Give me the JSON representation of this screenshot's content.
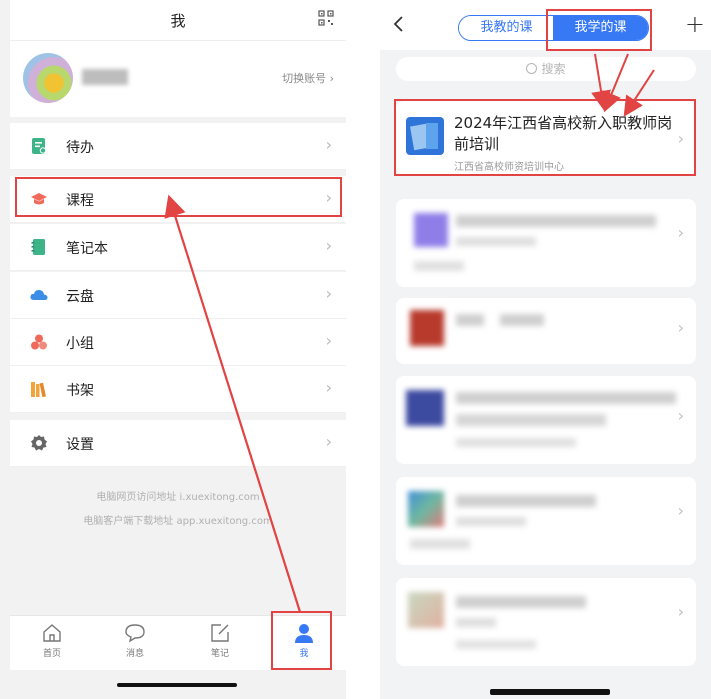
{
  "left": {
    "header_title": "我",
    "switch_account": "切换账号",
    "menu": [
      {
        "label": "待办",
        "icon": "todo-icon",
        "color": "#3eb489"
      },
      {
        "label": "课程",
        "icon": "course-icon",
        "color": "#ef6a5a"
      },
      {
        "label": "笔记本",
        "icon": "notebook-icon",
        "color": "#3eb489"
      },
      {
        "label": "云盘",
        "icon": "cloud-icon",
        "color": "#3a8ee6"
      },
      {
        "label": "小组",
        "icon": "group-icon",
        "color": "#ef6a5a"
      },
      {
        "label": "书架",
        "icon": "bookshelf-icon",
        "color": "#f2a33a"
      },
      {
        "label": "设置",
        "icon": "gear-icon",
        "color": "#666666"
      }
    ],
    "footer": [
      "电脑网页访问地址 i.xuexitong.com",
      "电脑客户端下载地址 app.xuexitong.com"
    ],
    "tabs": [
      {
        "label": "首页",
        "icon": "home-icon"
      },
      {
        "label": "消息",
        "icon": "message-icon"
      },
      {
        "label": "笔记",
        "icon": "note-icon"
      },
      {
        "label": "我",
        "icon": "profile-icon",
        "active": true
      }
    ]
  },
  "right": {
    "segments": [
      "我教的课",
      "我学的课"
    ],
    "search_placeholder": "搜索",
    "course": {
      "title": "2024年江西省高校新入职教师岗前培训",
      "org": "江西省高校师资培训中心"
    }
  },
  "colors": {
    "accent": "#3778f5",
    "annotation": "#e24343"
  }
}
